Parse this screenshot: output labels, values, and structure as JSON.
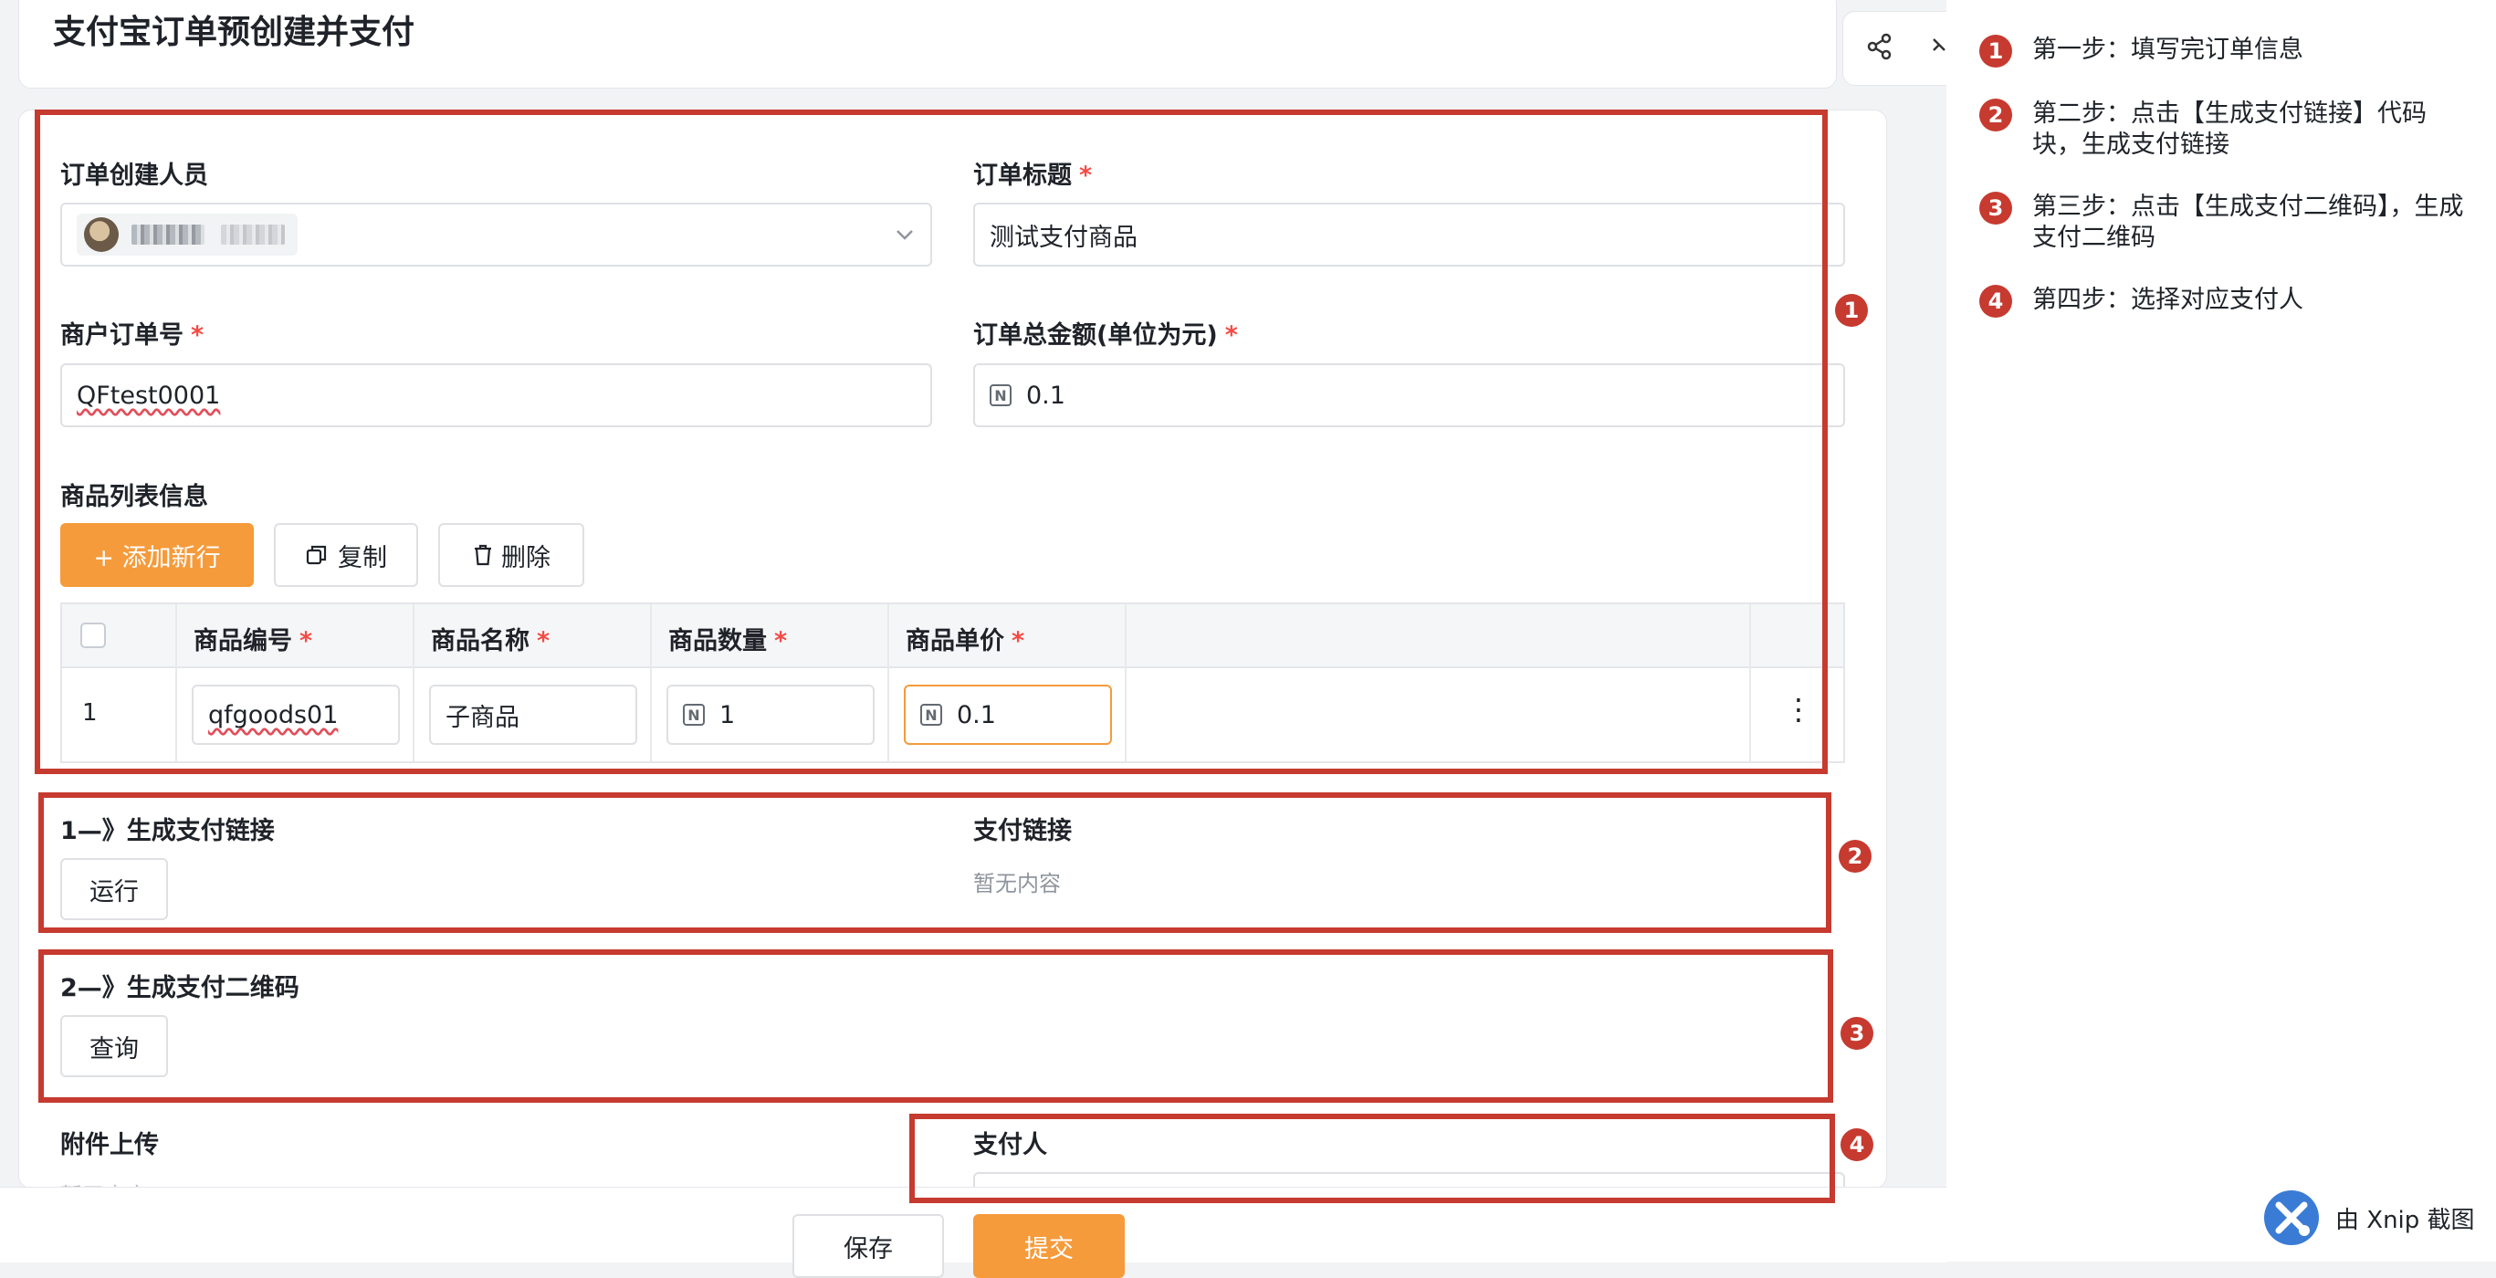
{
  "header": {
    "title": "支付宝订单预创建并支付"
  },
  "top_actions": {
    "share_icon": "share-icon",
    "close_icon": "close-icon"
  },
  "form": {
    "creator_label": "订单创建人员",
    "order_title_label": "订单标题",
    "order_title_value": "测试支付商品",
    "merchant_order_label": "商户订单号",
    "merchant_order_value": "QFtest0001",
    "total_amount_label": "订单总金额(单位为元)",
    "total_amount_value": "0.1",
    "product_list_label": "商品列表信息",
    "required_mark": "*"
  },
  "toolbar": {
    "add_label": "+ 添加新行",
    "copy_label": "复制",
    "delete_label": "删除"
  },
  "table": {
    "columns": [
      "商品编号",
      "商品名称",
      "商品数量",
      "商品单价"
    ],
    "rows": [
      {
        "index": "1",
        "code": "qfgoods01",
        "name": "子商品",
        "quantity": "1",
        "price": "0.1"
      }
    ],
    "row_menu": "⋮"
  },
  "link_section": {
    "title": "1—》生成支付链接",
    "run_label": "运行",
    "link_label": "支付链接",
    "link_value": "暂无内容"
  },
  "qr_section": {
    "title": "2—》生成支付二维码",
    "query_label": "查询"
  },
  "bottom": {
    "attachment_label": "附件上传",
    "attachment_value": "暂无内容",
    "payer_label": "支付人"
  },
  "footer": {
    "save_label": "保存",
    "submit_label": "提交"
  },
  "steps": [
    {
      "num": "1",
      "text": "第一步：填写完订单信息"
    },
    {
      "num": "2",
      "text": "第二步：点击【生成支付链接】代码块，生成支付链接"
    },
    {
      "num": "3",
      "text": "第三步：点击【生成支付二维码】，生成支付二维码"
    },
    {
      "num": "4",
      "text": "第四步：选择对应支付人"
    }
  ],
  "watermark": {
    "text": "由 Xnip 截图"
  },
  "colors": {
    "annotation_red": "#c63a30",
    "primary_orange": "#f59b3b",
    "required_red": "#f54a45"
  }
}
